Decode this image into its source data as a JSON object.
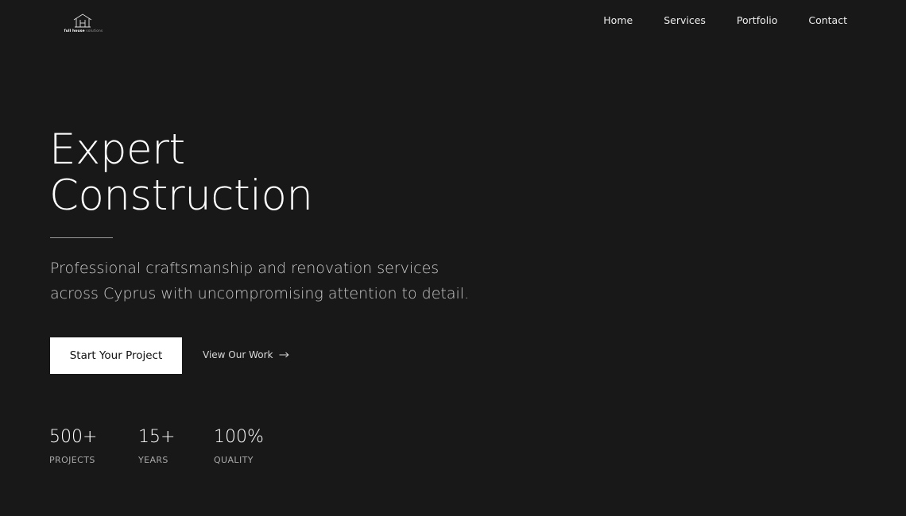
{
  "brand": {
    "logo_name_bold": "full house",
    "logo_name_light": "solutions"
  },
  "nav": {
    "items": [
      {
        "label": "Home"
      },
      {
        "label": "Services"
      },
      {
        "label": "Portfolio"
      },
      {
        "label": "Contact"
      }
    ]
  },
  "hero": {
    "title_line1": "Expert",
    "title_line2": "Construction",
    "subtitle": "Professional craftsmanship and renovation services across Cyprus with uncompromising attention to detail.",
    "primary_button": "Start Your Project",
    "secondary_link": "View Our Work",
    "secondary_link_icon": "arrow-right-icon"
  },
  "stats": [
    {
      "value": "500+",
      "label": "PROJECTS"
    },
    {
      "value": "15+",
      "label": "YEARS"
    },
    {
      "value": "100%",
      "label": "QUALITY"
    }
  ],
  "colors": {
    "background": "#181818",
    "text": "#ffffff",
    "muted": "#a8a8a8",
    "button_bg": "#ffffff",
    "button_text": "#111111"
  }
}
